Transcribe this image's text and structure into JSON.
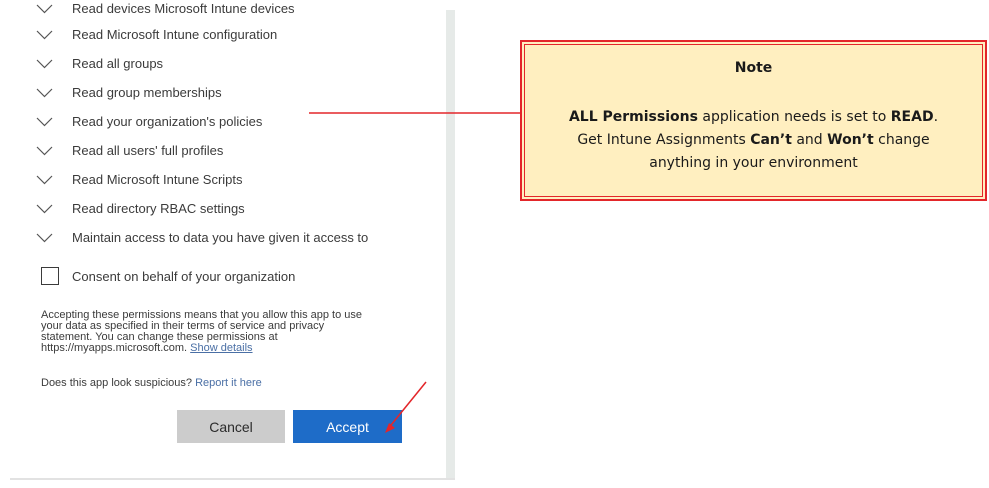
{
  "permissions": [
    "Read devices Microsoft Intune devices",
    "Read Microsoft Intune configuration",
    "Read all groups",
    "Read group memberships",
    "Read your organization's policies",
    "Read all users' full profiles",
    "Read Microsoft Intune Scripts",
    "Read directory RBAC settings",
    "Maintain access to data you have given it access to"
  ],
  "consent": {
    "label": "Consent on behalf of your organization",
    "checked": false
  },
  "disclaimer": {
    "line1": "Accepting these permissions means that you allow this app to use",
    "line2": "your data as specified in their terms of service and privacy",
    "line3": "statement. You can change these permissions at",
    "line4": "https://myapps.microsoft.com.",
    "show_details": "Show details"
  },
  "suspicious": {
    "question": "Does this app look suspicious?",
    "report_link": "Report it here"
  },
  "buttons": {
    "cancel": "Cancel",
    "accept": "Accept"
  },
  "note": {
    "title": "Note",
    "part1": "ALL Permissions",
    "part2": " application needs is set to ",
    "part3": "READ",
    "part4": ".",
    "part5": "Get Intune Assignments ",
    "part6": "Can’t",
    "part7": " and ",
    "part8": "Won’t",
    "part9": " change",
    "part10": "anything in your environment"
  },
  "colors": {
    "accept_button": "#1e6cc8",
    "cancel_button": "#cccccc",
    "annotation_red": "#e3262a",
    "note_background": "#ffefc0",
    "link": "#4a6fa5"
  },
  "icons": {
    "permission_expander": "chevron-down-icon"
  }
}
